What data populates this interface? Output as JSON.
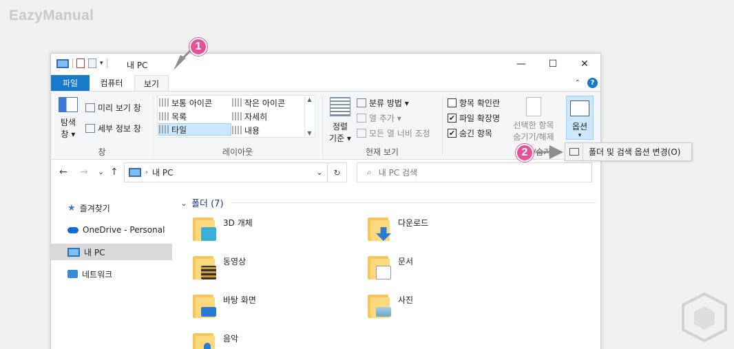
{
  "brand": "EazyManual",
  "window": {
    "title": "내 PC",
    "controls": {
      "minimize": "—",
      "maximize": "☐",
      "close": "✕"
    }
  },
  "tabs": {
    "file": "파일",
    "computer": "컴퓨터",
    "view": "보기"
  },
  "ribbon": {
    "pane": {
      "nav_pane_l1": "탐색",
      "nav_pane_l2": "창 ▾",
      "preview": "미리 보기 창",
      "details": "세부 정보 창",
      "label": "창"
    },
    "layout": {
      "items": [
        "보통 아이콘",
        "작은 아이콘",
        "목록",
        "자세히",
        "타일",
        "내용"
      ],
      "label": "레이아웃"
    },
    "current_view": {
      "sort_l1": "정렬",
      "sort_l2": "기준 ▾",
      "group_by": "분류 방법 ▾",
      "add_columns": "열 추가 ▾",
      "size_columns": "모든 열 너비 조정",
      "label": "현재 보기"
    },
    "show_hide": {
      "item_checkboxes": {
        "label": "항목 확인란",
        "checked": false
      },
      "file_extensions": {
        "label": "파일 확장명",
        "checked": true
      },
      "hidden_items": {
        "label": "숨긴 항목",
        "checked": true
      },
      "hide_selected_l1": "선택한 항목",
      "hide_selected_l2": "숨기기/해제",
      "label": "표시/숨기"
    },
    "options": {
      "label": "옵션",
      "arrow": "▾"
    }
  },
  "dropdown": {
    "label": "폴더 및 검색 옵션 변경(O)"
  },
  "address": {
    "path": "내 PC",
    "chevron": "⌄",
    "refresh": "↻"
  },
  "search": {
    "placeholder": "내 PC 검색",
    "icon": "⌕"
  },
  "nav_buttons": {
    "back": "←",
    "forward": "→",
    "recent": "⌄",
    "up": "↑"
  },
  "nav_pane": {
    "items": [
      {
        "label": "즐겨찾기",
        "icon": "star-icon"
      },
      {
        "label": "OneDrive - Personal",
        "icon": "cloud-icon"
      },
      {
        "label": "내 PC",
        "icon": "pc-icon",
        "selected": true
      },
      {
        "label": "네트워크",
        "icon": "network-icon"
      }
    ]
  },
  "content": {
    "section_title": "폴더 (7)",
    "chevron": "⌄",
    "folders": [
      {
        "name": "3D 개체",
        "icon": "3d-objects-icon",
        "accent": "#3ab0d8"
      },
      {
        "name": "다운로드",
        "icon": "downloads-icon",
        "accent": "#2a7bd4"
      },
      {
        "name": "동영상",
        "icon": "videos-icon",
        "accent": "#333333"
      },
      {
        "name": "문서",
        "icon": "documents-icon",
        "accent": "#ffffff"
      },
      {
        "name": "바탕 화면",
        "icon": "desktop-icon",
        "accent": "#2a7bd4"
      },
      {
        "name": "사진",
        "icon": "pictures-icon",
        "accent": "#6fa3c8"
      },
      {
        "name": "음악",
        "icon": "music-icon",
        "accent": "#2a7bd4"
      }
    ]
  },
  "markers": {
    "one": "1",
    "two": "2"
  },
  "colors": {
    "accent": "#1979ca",
    "marker": "#e45296",
    "selected": "#cce8ff"
  }
}
